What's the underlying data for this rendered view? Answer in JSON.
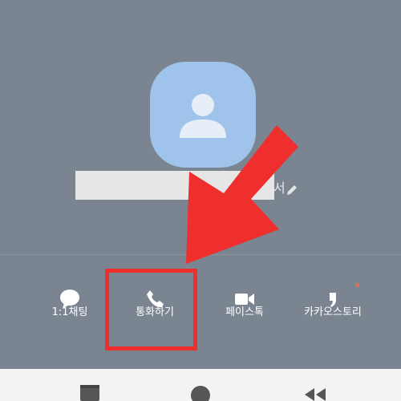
{
  "profile": {
    "avatar_icon": "person-silhouette-icon",
    "edit_icon": "pencil-icon",
    "name_tail": "서"
  },
  "actions": [
    {
      "label": "1:1채팅",
      "icon": "chat-bubble-icon"
    },
    {
      "label": "통화하기",
      "icon": "phone-icon"
    },
    {
      "label": "페이스톡",
      "icon": "video-camera-icon"
    },
    {
      "label": "카카오스토리",
      "icon": "kakaostory-icon",
      "badge": true
    }
  ],
  "navbar": {
    "buttons": [
      "recent-apps-icon",
      "home-icon",
      "back-icon"
    ]
  },
  "colors": {
    "background": "#7b8591",
    "avatar": "#9fc3ea",
    "annotation": "#ef2e2e",
    "navbar": "#f3f3f3"
  }
}
